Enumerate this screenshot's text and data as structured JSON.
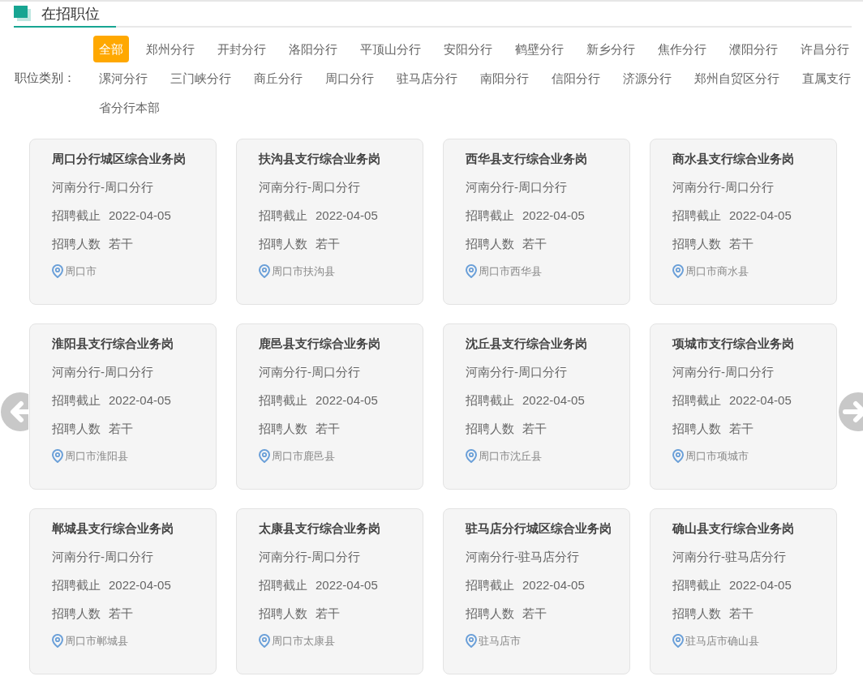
{
  "section_title": "在招职位",
  "filter": {
    "label": "职位类别：",
    "items": [
      {
        "label": "全部",
        "selected": true
      },
      {
        "label": "郑州分行",
        "selected": false
      },
      {
        "label": "开封分行",
        "selected": false
      },
      {
        "label": "洛阳分行",
        "selected": false
      },
      {
        "label": "平顶山分行",
        "selected": false
      },
      {
        "label": "安阳分行",
        "selected": false
      },
      {
        "label": "鹤壁分行",
        "selected": false
      },
      {
        "label": "新乡分行",
        "selected": false
      },
      {
        "label": "焦作分行",
        "selected": false
      },
      {
        "label": "濮阳分行",
        "selected": false
      },
      {
        "label": "许昌分行",
        "selected": false
      },
      {
        "label": "漯河分行",
        "selected": false
      },
      {
        "label": "三门峡分行",
        "selected": false
      },
      {
        "label": "商丘分行",
        "selected": false
      },
      {
        "label": "周口分行",
        "selected": false
      },
      {
        "label": "驻马店分行",
        "selected": false
      },
      {
        "label": "南阳分行",
        "selected": false
      },
      {
        "label": "信阳分行",
        "selected": false
      },
      {
        "label": "济源分行",
        "selected": false
      },
      {
        "label": "郑州自贸区分行",
        "selected": false
      },
      {
        "label": "直属支行",
        "selected": false
      },
      {
        "label": "省分行本部",
        "selected": false
      }
    ]
  },
  "jobs": [
    {
      "title": "周口分行城区综合业务岗",
      "org": "河南分行-周口分行",
      "deadline_label": "招聘截止",
      "deadline": "2022-04-05",
      "count_label": "招聘人数",
      "count": "若干",
      "location": "周口市"
    },
    {
      "title": "扶沟县支行综合业务岗",
      "org": "河南分行-周口分行",
      "deadline_label": "招聘截止",
      "deadline": "2022-04-05",
      "count_label": "招聘人数",
      "count": "若干",
      "location": "周口市扶沟县"
    },
    {
      "title": "西华县支行综合业务岗",
      "org": "河南分行-周口分行",
      "deadline_label": "招聘截止",
      "deadline": "2022-04-05",
      "count_label": "招聘人数",
      "count": "若干",
      "location": "周口市西华县"
    },
    {
      "title": "商水县支行综合业务岗",
      "org": "河南分行-周口分行",
      "deadline_label": "招聘截止",
      "deadline": "2022-04-05",
      "count_label": "招聘人数",
      "count": "若干",
      "location": "周口市商水县"
    },
    {
      "title": "淮阳县支行综合业务岗",
      "org": "河南分行-周口分行",
      "deadline_label": "招聘截止",
      "deadline": "2022-04-05",
      "count_label": "招聘人数",
      "count": "若干",
      "location": "周口市淮阳县"
    },
    {
      "title": "鹿邑县支行综合业务岗",
      "org": "河南分行-周口分行",
      "deadline_label": "招聘截止",
      "deadline": "2022-04-05",
      "count_label": "招聘人数",
      "count": "若干",
      "location": "周口市鹿邑县"
    },
    {
      "title": "沈丘县支行综合业务岗",
      "org": "河南分行-周口分行",
      "deadline_label": "招聘截止",
      "deadline": "2022-04-05",
      "count_label": "招聘人数",
      "count": "若干",
      "location": "周口市沈丘县"
    },
    {
      "title": "项城市支行综合业务岗",
      "org": "河南分行-周口分行",
      "deadline_label": "招聘截止",
      "deadline": "2022-04-05",
      "count_label": "招聘人数",
      "count": "若干",
      "location": "周口市项城市"
    },
    {
      "title": "郸城县支行综合业务岗",
      "org": "河南分行-周口分行",
      "deadline_label": "招聘截止",
      "deadline": "2022-04-05",
      "count_label": "招聘人数",
      "count": "若干",
      "location": "周口市郸城县"
    },
    {
      "title": "太康县支行综合业务岗",
      "org": "河南分行-周口分行",
      "deadline_label": "招聘截止",
      "deadline": "2022-04-05",
      "count_label": "招聘人数",
      "count": "若干",
      "location": "周口市太康县"
    },
    {
      "title": "驻马店分行城区综合业务岗",
      "org": "河南分行-驻马店分行",
      "deadline_label": "招聘截止",
      "deadline": "2022-04-05",
      "count_label": "招聘人数",
      "count": "若干",
      "location": "驻马店市"
    },
    {
      "title": "确山县支行综合业务岗",
      "org": "河南分行-驻马店分行",
      "deadline_label": "招聘截止",
      "deadline": "2022-04-05",
      "count_label": "招聘人数",
      "count": "若干",
      "location": "驻马店市确山县"
    }
  ]
}
